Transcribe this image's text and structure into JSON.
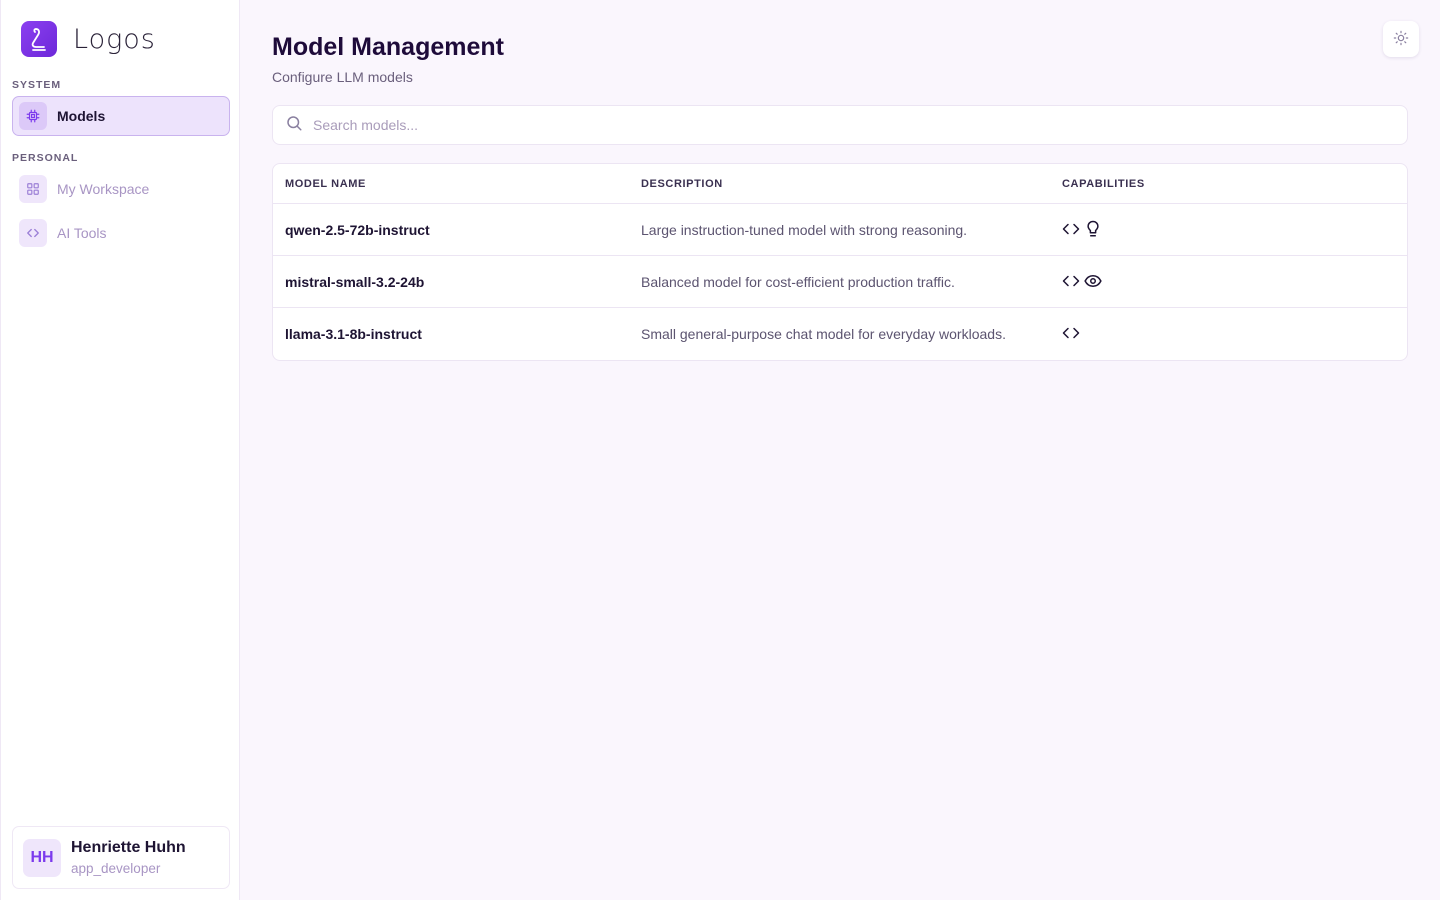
{
  "app": {
    "name": "Logos"
  },
  "sidebar": {
    "sections": [
      {
        "label": "SYSTEM",
        "items": [
          {
            "label": "Models",
            "icon": "cpu-icon",
            "active": true
          }
        ]
      },
      {
        "label": "PERSONAL",
        "items": [
          {
            "label": "My Workspace",
            "icon": "grid-icon",
            "active": false
          },
          {
            "label": "AI Tools",
            "icon": "code-icon",
            "active": false
          }
        ]
      }
    ],
    "user": {
      "initials": "HH",
      "name": "Henriette Huhn",
      "role": "app_developer"
    }
  },
  "header": {
    "title": "Model Management",
    "subtitle": "Configure LLM models",
    "theme_toggle_icon": "sun-icon"
  },
  "search": {
    "placeholder": "Search models...",
    "value": ""
  },
  "table": {
    "columns": [
      "MODEL NAME",
      "DESCRIPTION",
      "CAPABILITIES"
    ],
    "rows": [
      {
        "name": "qwen-2.5-72b-instruct",
        "description": "Large instruction-tuned model with strong reasoning.",
        "capabilities": [
          "code-icon",
          "lightbulb-icon"
        ]
      },
      {
        "name": "mistral-small-3.2-24b",
        "description": "Balanced model for cost-efficient production traffic.",
        "capabilities": [
          "code-icon",
          "eye-icon"
        ]
      },
      {
        "name": "llama-3.1-8b-instruct",
        "description": "Small general-purpose chat model for everyday workloads.",
        "capabilities": [
          "code-icon"
        ]
      }
    ]
  },
  "colors": {
    "accent": "#7c3aed",
    "background": "#faf6fd",
    "active_nav": "#ede3fc"
  }
}
